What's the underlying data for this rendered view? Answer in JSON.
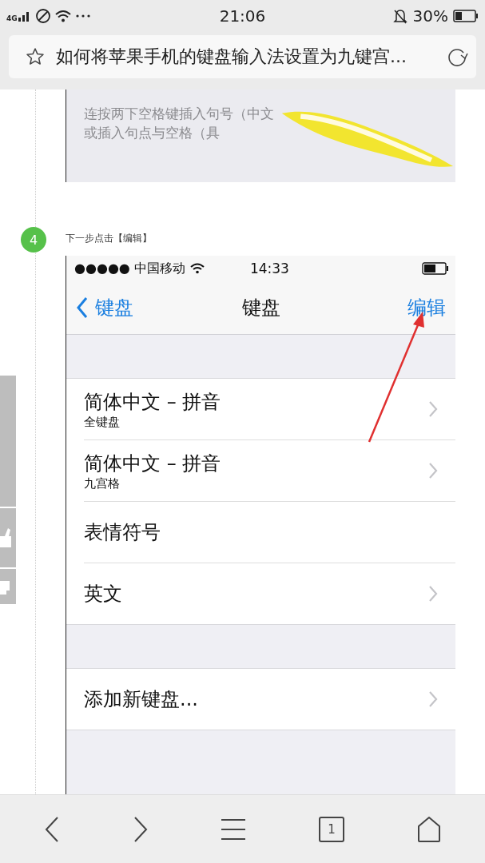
{
  "status_bar": {
    "network": "4G",
    "time": "21:06",
    "battery": "30%"
  },
  "address_bar": {
    "title": "如何将苹果手机的键盘输入法设置为九键宫..."
  },
  "prev_image": {
    "lines": [
      "连按两下空格键插入句号（中文",
      "或插入句点与空格（具"
    ]
  },
  "step": {
    "number": "4",
    "text": "下一步点击【编辑】"
  },
  "ios_screenshot": {
    "status": {
      "carrier": "●●●●● 中国移动",
      "time": "14:33"
    },
    "nav": {
      "back": "键盘",
      "title": "键盘",
      "action": "编辑"
    },
    "groups": [
      [
        {
          "title": "简体中文 – 拼音",
          "subtitle": "全键盘",
          "chevron": true
        },
        {
          "title": "简体中文 – 拼音",
          "subtitle": "九宫格",
          "chevron": true
        },
        {
          "title": "表情符号",
          "chevron": false
        },
        {
          "title": "英文",
          "chevron": true
        }
      ],
      [
        {
          "title": "添加新键盘...",
          "chevron": true
        }
      ]
    ]
  },
  "toolbar": {
    "tab_count": "1"
  }
}
